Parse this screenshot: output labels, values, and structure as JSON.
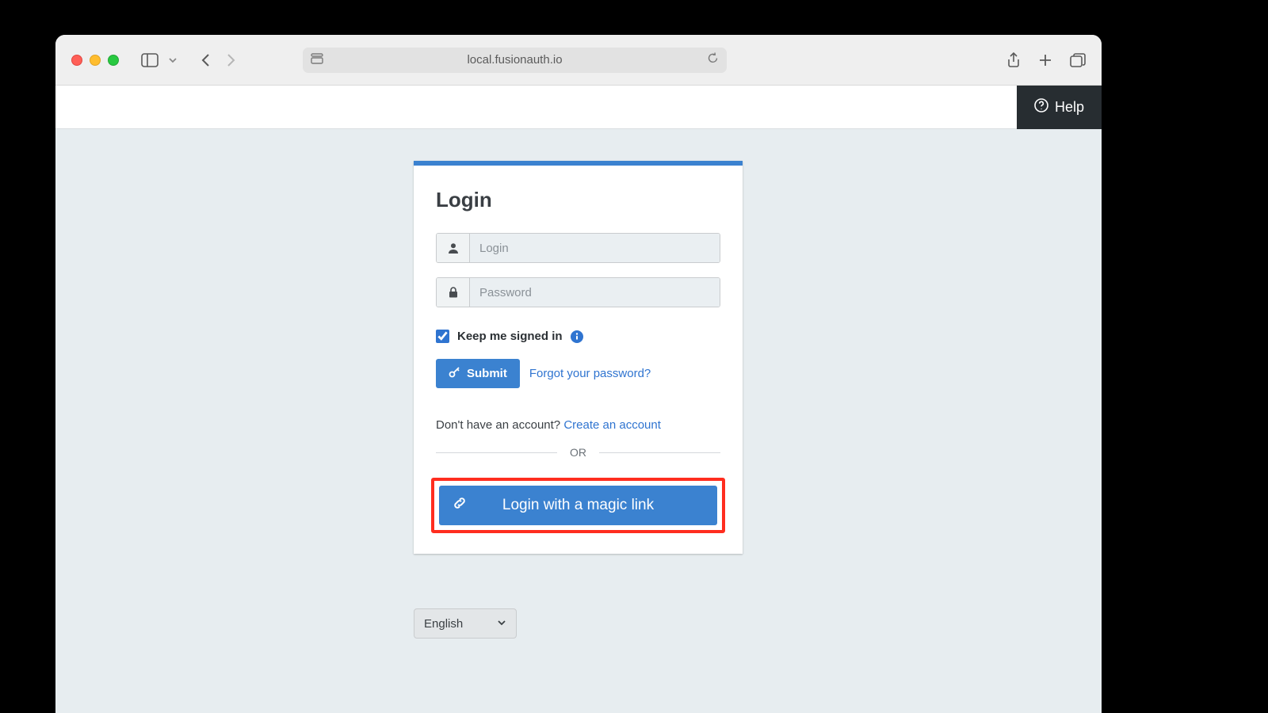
{
  "browser": {
    "address": "local.fusionauth.io"
  },
  "help": {
    "label": "Help"
  },
  "login": {
    "title": "Login",
    "login_placeholder": "Login",
    "password_placeholder": "Password",
    "keep_signed_in_label": "Keep me signed in",
    "submit_label": "Submit",
    "forgot_password_label": "Forgot your password?",
    "no_account_text": "Don't have an account? ",
    "create_account_label": "Create an account",
    "divider_label": "OR",
    "magic_link_label": "Login with a magic link"
  },
  "language": {
    "selected": "English"
  }
}
